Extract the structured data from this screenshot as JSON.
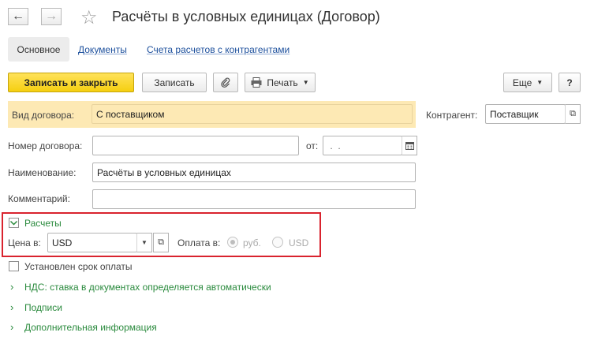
{
  "nav": {
    "back_icon": "←",
    "forward_icon": "→",
    "star_icon": "☆"
  },
  "window": {
    "title": "Расчёты в условных единицах (Договор)"
  },
  "tabs": [
    {
      "label": "Основное"
    },
    {
      "label": "Документы"
    },
    {
      "label": "Счета расчетов с контрагентами"
    }
  ],
  "toolbar": {
    "save_close": "Записать и закрыть",
    "save": "Записать",
    "attach_icon": "📎",
    "print": "Печать",
    "more": "Еще",
    "help": "?"
  },
  "form": {
    "contract_type_label": "Вид договора:",
    "contract_type_value": "С поставщиком",
    "counterparty_label": "Контрагент:",
    "counterparty_value": "Поставщик",
    "number_label": "Номер договора:",
    "number_value": "",
    "date_label": "от:",
    "date_value": " .  .",
    "name_label": "Наименование:",
    "name_value": "Расчёты в условных единицах",
    "comment_label": "Комментарий:",
    "comment_value": ""
  },
  "settlements": {
    "group_label": "Расчеты",
    "price_label": "Цена в:",
    "price_currency": "USD",
    "payment_label": "Оплата в:",
    "payment_options": [
      "руб.",
      "USD"
    ]
  },
  "extra": {
    "payment_term_label": "Установлен срок оплаты",
    "vat_label": "НДС: ставка в документах определяется автоматически",
    "signatures_label": "Подписи",
    "additional_label": "Дополнительная информация"
  },
  "colors": {
    "primary_button": "#f5cf10",
    "highlight_row": "#fde9b4",
    "group_link": "#2a8a3d",
    "tab_link": "#1c4f9c",
    "annotation_box": "#d9232e"
  }
}
